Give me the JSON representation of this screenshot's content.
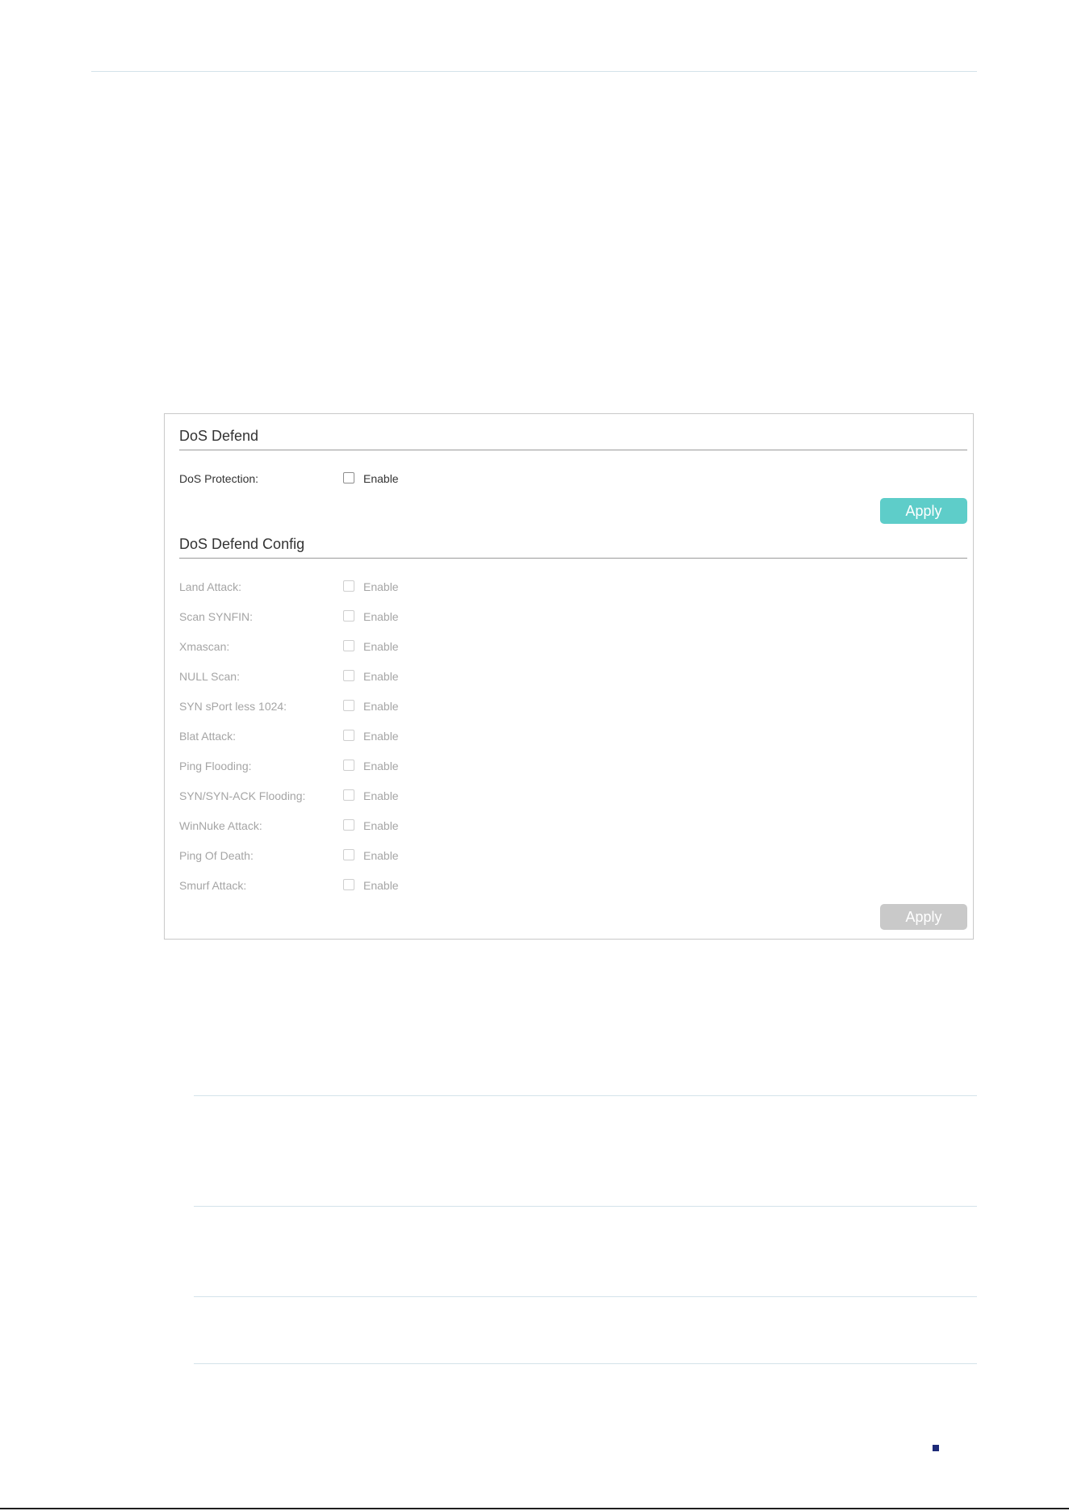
{
  "dos_defend": {
    "title": "DoS Defend",
    "protection": {
      "label": "DoS Protection:",
      "checkbox_label": "Enable",
      "checked": false
    },
    "apply_label": "Apply"
  },
  "dos_defend_config": {
    "title": "DoS Defend Config",
    "items": [
      {
        "label": "Land Attack:",
        "checkbox_label": "Enable",
        "checked": false
      },
      {
        "label": "Scan SYNFIN:",
        "checkbox_label": "Enable",
        "checked": false
      },
      {
        "label": "Xmascan:",
        "checkbox_label": "Enable",
        "checked": false
      },
      {
        "label": "NULL Scan:",
        "checkbox_label": "Enable",
        "checked": false
      },
      {
        "label": "SYN sPort less 1024:",
        "checkbox_label": "Enable",
        "checked": false
      },
      {
        "label": "Blat Attack:",
        "checkbox_label": "Enable",
        "checked": false
      },
      {
        "label": "Ping Flooding:",
        "checkbox_label": "Enable",
        "checked": false
      },
      {
        "label": "SYN/SYN-ACK Flooding:",
        "checkbox_label": "Enable",
        "checked": false
      },
      {
        "label": "WinNuke Attack:",
        "checkbox_label": "Enable",
        "checked": false
      },
      {
        "label": "Ping Of Death:",
        "checkbox_label": "Enable",
        "checked": false
      },
      {
        "label": "Smurf Attack:",
        "checkbox_label": "Enable",
        "checked": false
      }
    ],
    "apply_label": "Apply"
  },
  "colors": {
    "apply_active": "#5ecdc9",
    "apply_disabled": "#c9c9c9",
    "page_marker": "#1d2a78"
  }
}
